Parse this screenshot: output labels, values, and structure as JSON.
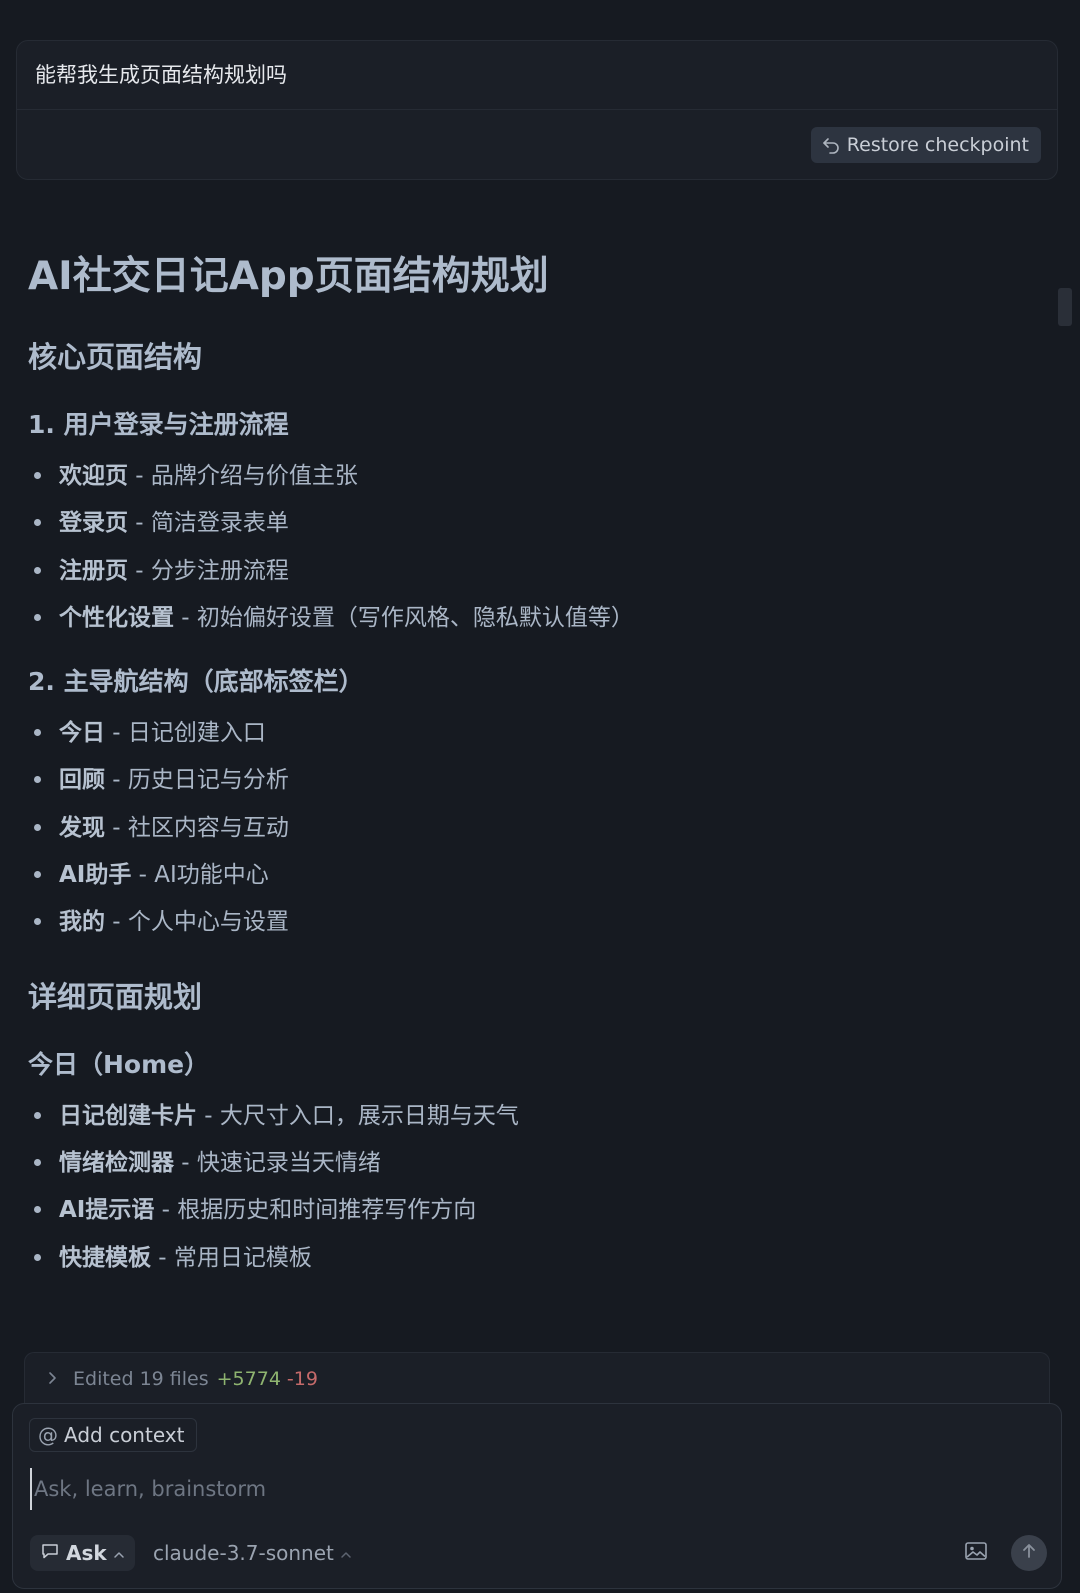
{
  "user_message": {
    "text": "能帮我生成页面结构规划吗",
    "restore_label": "Restore checkpoint"
  },
  "doc": {
    "title": "AI社交日记App页面结构规划",
    "section1": {
      "heading": "核心页面结构",
      "sub1": {
        "heading": "1. 用户登录与注册流程",
        "items": [
          {
            "bold": "欢迎页",
            "text": " - 品牌介绍与价值主张"
          },
          {
            "bold": "登录页",
            "text": " - 简洁登录表单"
          },
          {
            "bold": "注册页",
            "text": " - 分步注册流程"
          },
          {
            "bold": "个性化设置",
            "text": " - 初始偏好设置（写作风格、隐私默认值等）"
          }
        ]
      },
      "sub2": {
        "heading": "2. 主导航结构（底部标签栏）",
        "items": [
          {
            "bold": "今日",
            "text": " - 日记创建入口"
          },
          {
            "bold": "回顾",
            "text": " - 历史日记与分析"
          },
          {
            "bold": "发现",
            "text": " - 社区内容与互动"
          },
          {
            "bold": "AI助手",
            "text": " - AI功能中心"
          },
          {
            "bold": "我的",
            "text": " - 个人中心与设置"
          }
        ]
      }
    },
    "section2": {
      "heading": "详细页面规划",
      "sub1": {
        "heading": "今日（Home）",
        "items": [
          {
            "bold": "日记创建卡片",
            "text": " - 大尺寸入口，展示日期与天气"
          },
          {
            "bold": "情绪检测器",
            "text": " - 快速记录当天情绪"
          },
          {
            "bold": "AI提示语",
            "text": " - 根据历史和时间推荐写作方向"
          },
          {
            "bold": "快捷模板",
            "text": " - 常用日记模板"
          }
        ]
      }
    }
  },
  "edited": {
    "label": "Edited 19 files",
    "additions": "+5774",
    "deletions": "-19"
  },
  "composer": {
    "add_context_label": "Add context",
    "placeholder": "Ask, learn, brainstorm",
    "mode_label": "Ask",
    "model_label": "claude-3.7-sonnet"
  },
  "icons": {
    "restore": "undo-arrow-icon",
    "expand": "chevron-right-icon",
    "at": "at-icon",
    "mode": "chat-bubble-icon",
    "mode_chevron": "chevron-up-icon",
    "model_chevron": "chevron-up-icon",
    "image": "image-icon",
    "send": "arrow-up-icon"
  },
  "colors": {
    "background": "#161a21",
    "heading": "#aebbcc",
    "body_text": "#aab6c6",
    "additions": "#8fb470",
    "deletions": "#c56a6a"
  }
}
